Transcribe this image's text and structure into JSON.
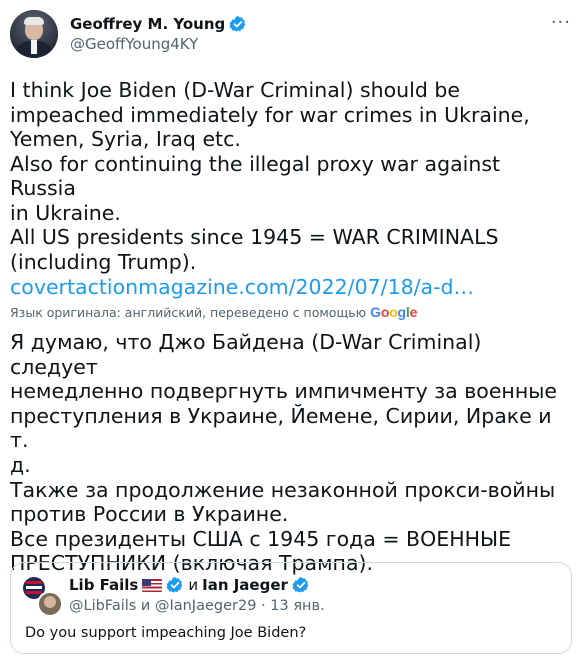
{
  "author": {
    "name": "Geoffrey M. Young",
    "handle": "@GeoffYoung4KY"
  },
  "menu_icon": "more-icon",
  "tweet": {
    "text": "I think Joe Biden (D-War Criminal) should be\nimpeached immediately for war crimes in Ukraine,\nYemen, Syria, Iraq etc.\nAlso for continuing the illegal proxy war against Russia\nin Ukraine.\nAll US presidents since 1945 = WAR CRIMINALS\n(including Trump).",
    "link": "covertactionmagazine.com/2022/07/18/a-d…",
    "translation_note": "Язык оригинала: английский, переведено с помощью",
    "translation_provider": "Google",
    "translated_text": "Я думаю, что Джо Байдена (D-War Criminal) следует\nнемедленно подвергнуть импичменту за военные\nпреступления в Украине, Йемене, Сирии, Ираке и т.\nд.\nТакже за продолжение незаконной прокси-войны\nпротив России в Украине.\nВсе президенты США с 1945 года = ВОЕННЫЕ\nПРЕСТУПНИКИ (включая Трампа)."
  },
  "quoted": {
    "name1": "Lib Fails",
    "conjunction": "и",
    "name2": "Ian Jaeger",
    "meta": "@LibFails и @IanJaeger29 · 13 янв.",
    "text": "Do you support impeaching Joe Biden?"
  },
  "colors": {
    "link": "#1d9bf0",
    "verified": "#1d9bf0",
    "muted": "#536471",
    "text": "#0f1419"
  }
}
